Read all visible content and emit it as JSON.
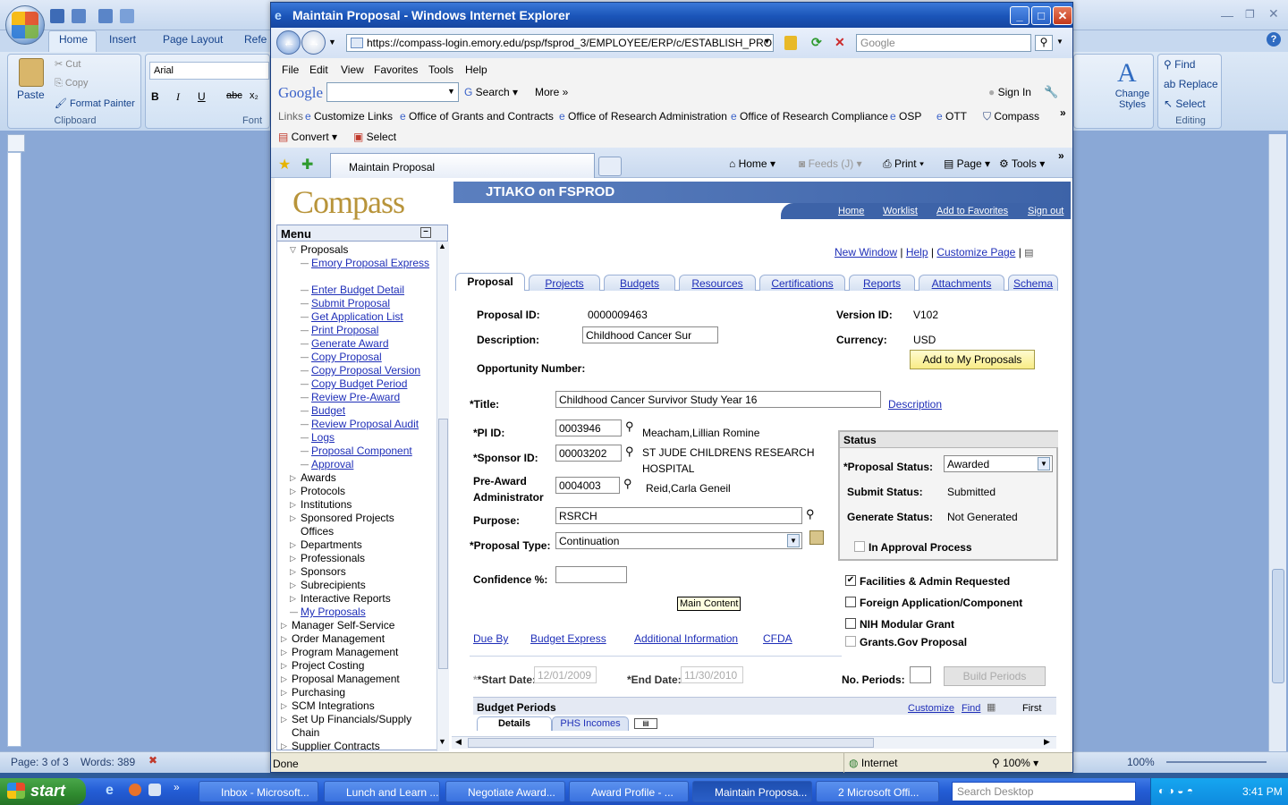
{
  "word": {
    "tabs": [
      "Home",
      "Insert",
      "Page Layout",
      "Refe"
    ],
    "clipboard": {
      "paste": "Paste",
      "cut": "Cut",
      "copy": "Copy",
      "format_painter": "Format Painter",
      "label": "Clipboard"
    },
    "font": {
      "name": "Arial",
      "label": "Font"
    },
    "styles": {
      "change_styles": "Change Styles"
    },
    "editing": {
      "find": "Find",
      "replace": "Replace",
      "select": "Select",
      "label": "Editing"
    },
    "status": {
      "page": "Page: 3 of 3",
      "words": "Words: 389",
      "zoom": "100%"
    }
  },
  "ie": {
    "title": "Maintain Proposal - Windows Internet Explorer",
    "url": "https://compass-login.emory.edu/psp/fsprod_3/EMPLOYEE/ERP/c/ESTABLISH_PROPOSAL.G",
    "search_placeholder": "Google",
    "menu": [
      "File",
      "Edit",
      "View",
      "Favorites",
      "Tools",
      "Help"
    ],
    "google": {
      "logo": "Google",
      "search": "Search",
      "more": "More",
      "sign_in": "Sign In"
    },
    "links_label": "Links",
    "links": [
      "Customize Links",
      "Office of Grants and Contracts",
      "Office of Research Administration",
      "Office of Research Compliance",
      "OSP",
      "OTT",
      "Compass"
    ],
    "convert": "Convert",
    "select": "Select",
    "tab_title": "Maintain Proposal",
    "commands": {
      "home": "Home",
      "feeds": "Feeds (J)",
      "print": "Print",
      "page": "Page",
      "tools": "Tools"
    },
    "status_done": "Done",
    "status_zone": "Internet",
    "status_zoom": "100%"
  },
  "ps": {
    "logo": "Compass",
    "user": "JTIAKO on FSPROD",
    "nav": [
      "Home",
      "Worklist",
      "Add to Favorites",
      "Sign out"
    ],
    "menu_title": "Menu",
    "menu_items": [
      {
        "text": "Proposals",
        "type": "open",
        "indent": 1
      },
      {
        "text": "Emory Proposal Express",
        "type": "link",
        "indent": 2
      },
      {
        "text": "Maintain Proposal",
        "type": "selected",
        "indent": 2
      },
      {
        "text": "Enter Budget Detail",
        "type": "link",
        "indent": 2
      },
      {
        "text": "Submit Proposal",
        "type": "link",
        "indent": 2
      },
      {
        "text": "Get Application List",
        "type": "link",
        "indent": 2
      },
      {
        "text": "Print Proposal",
        "type": "link",
        "indent": 2
      },
      {
        "text": "Generate Award",
        "type": "link",
        "indent": 2
      },
      {
        "text": "Copy Proposal",
        "type": "link",
        "indent": 2
      },
      {
        "text": "Copy Proposal Version",
        "type": "link",
        "indent": 2
      },
      {
        "text": "Copy Budget Period",
        "type": "link",
        "indent": 2
      },
      {
        "text": "Review Pre-Award",
        "type": "link",
        "indent": 2
      },
      {
        "text": "Budget",
        "type": "link",
        "indent": 2
      },
      {
        "text": "Review Proposal Audit",
        "type": "link",
        "indent": 2
      },
      {
        "text": "Logs",
        "type": "link",
        "indent": 2
      },
      {
        "text": "Proposal Component",
        "type": "link",
        "indent": 2
      },
      {
        "text": "Approval",
        "type": "link",
        "indent": 2
      },
      {
        "text": "Awards",
        "type": "closed",
        "indent": 1
      },
      {
        "text": "Protocols",
        "type": "closed",
        "indent": 1
      },
      {
        "text": "Institutions",
        "type": "closed",
        "indent": 1
      },
      {
        "text": "Sponsored Projects",
        "type": "closed",
        "indent": 1
      },
      {
        "text": "Offices",
        "type": "cont",
        "indent": 1
      },
      {
        "text": "Departments",
        "type": "closed",
        "indent": 1
      },
      {
        "text": "Professionals",
        "type": "closed",
        "indent": 1
      },
      {
        "text": "Sponsors",
        "type": "closed",
        "indent": 1
      },
      {
        "text": "Subrecipients",
        "type": "closed",
        "indent": 1
      },
      {
        "text": "Interactive Reports",
        "type": "closed",
        "indent": 1
      },
      {
        "text": "My Proposals",
        "type": "link",
        "indent": 1
      },
      {
        "text": "Manager Self-Service",
        "type": "closed",
        "indent": 0
      },
      {
        "text": "Order Management",
        "type": "closed",
        "indent": 0
      },
      {
        "text": "Program Management",
        "type": "closed",
        "indent": 0
      },
      {
        "text": "Project Costing",
        "type": "closed",
        "indent": 0
      },
      {
        "text": "Proposal Management",
        "type": "closed",
        "indent": 0
      },
      {
        "text": "Purchasing",
        "type": "closed",
        "indent": 0
      },
      {
        "text": "SCM Integrations",
        "type": "closed",
        "indent": 0
      },
      {
        "text": "Set Up Financials/Supply",
        "type": "closed",
        "indent": 0
      },
      {
        "text": "Chain",
        "type": "cont",
        "indent": 0
      },
      {
        "text": "Supplier Contracts",
        "type": "closed",
        "indent": 0
      }
    ],
    "top_links": [
      "New Window",
      "Help",
      "Customize Page"
    ],
    "tabs": [
      "Proposal",
      "Projects",
      "Budgets",
      "Resources",
      "Certifications",
      "Reports",
      "Attachments",
      "Schema"
    ],
    "proposal_id_label": "Proposal ID:",
    "proposal_id": "0000009463",
    "description_label": "Description:",
    "description": "Childhood Cancer Sur",
    "version_label": "Version ID:",
    "version": "V102",
    "currency_label": "Currency:",
    "currency": "USD",
    "opportunity_label": "Opportunity Number:",
    "add_to_my": "Add to My Proposals",
    "title_label": "*Title:",
    "title": "Childhood Cancer Survivor Study Year 16",
    "description_link": "Description",
    "pi_label": "*PI ID:",
    "pi_id": "0003946",
    "pi_name": "Meacham,Lillian Romine",
    "sponsor_label": "*Sponsor ID:",
    "sponsor_id": "00003202",
    "sponsor_name_1": "ST JUDE CHILDRENS RESEARCH",
    "sponsor_name_2": "HOSPITAL",
    "preaward_label_1": "Pre-Award",
    "preaward_label_2": "Administrator",
    "preaward_id": "0004003",
    "preaward_name": "Reid,Carla Geneil",
    "purpose_label": "Purpose:",
    "purpose": "RSRCH",
    "proposal_type_label": "*Proposal Type:",
    "proposal_type": "Continuation",
    "confidence_label": "Confidence %:",
    "confidence": "",
    "tooltip": "Main Content",
    "status_box_title": "Status",
    "proposal_status_label": "*Proposal Status:",
    "proposal_status": "Awarded",
    "submit_status_label": "Submit Status:",
    "submit_status": "Submitted",
    "generate_status_label": "Generate Status:",
    "generate_status": "Not Generated",
    "approval_label": "In Approval Process",
    "checks": [
      {
        "label": "Facilities & Admin Requested",
        "checked": true
      },
      {
        "label": "Foreign Application/Component",
        "checked": false
      },
      {
        "label": "NIH Modular Grant",
        "checked": false
      },
      {
        "label": "Grants.Gov Proposal",
        "checked": false
      }
    ],
    "bottom_links": [
      "Due By",
      "Budget Express",
      "Additional Information",
      "CFDA"
    ],
    "start_date_label": "*Start Date:",
    "start_date": "12/01/2009",
    "end_date_label": "*End Date:",
    "end_date": "11/30/2010",
    "no_periods_label": "No. Periods:",
    "build_periods": "Build Periods",
    "budget_periods_title": "Budget Periods",
    "budget_links": [
      "Customize",
      "Find"
    ],
    "first": "First",
    "subtabs": [
      "Details",
      "PHS Incomes"
    ]
  },
  "taskbar": {
    "start": "start",
    "items": [
      "Inbox - Microsoft...",
      "Lunch and Learn ...",
      "Negotiate Award...",
      "Award Profile - ...",
      "Maintain Proposa...",
      "2 Microsoft Offi..."
    ],
    "search_placeholder": "Search Desktop",
    "time": "3:41 PM"
  }
}
